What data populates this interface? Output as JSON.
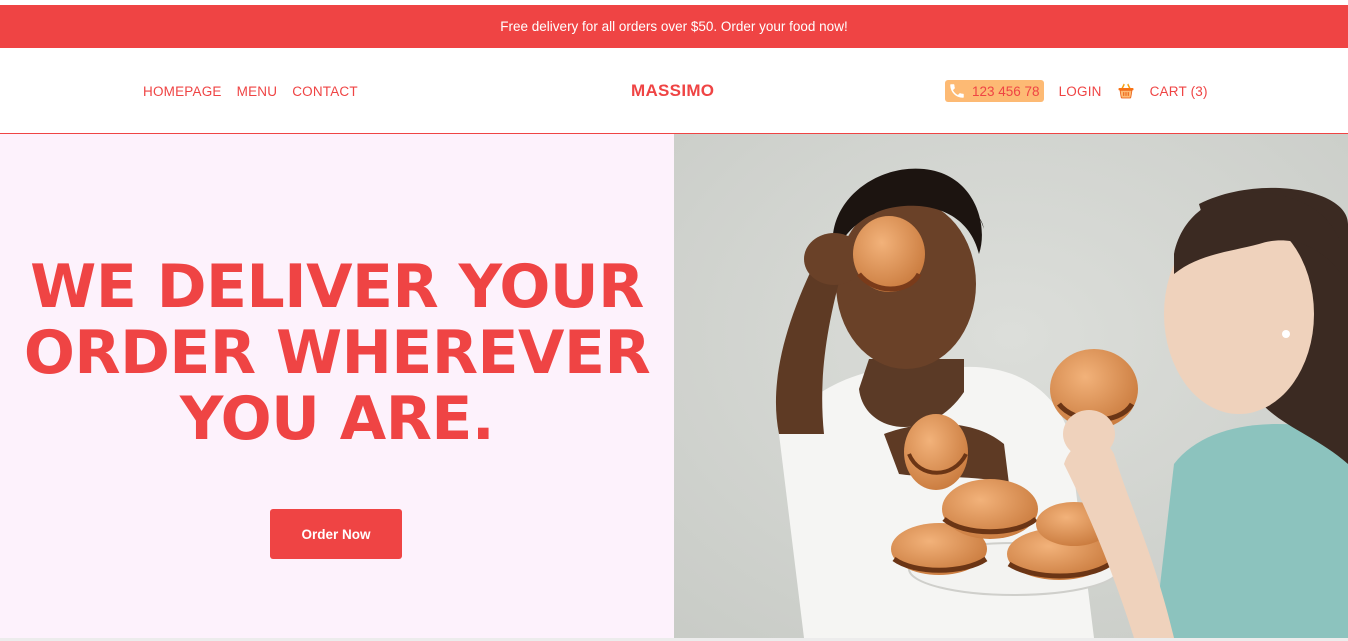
{
  "promo_banner": {
    "text": "Free delivery for all orders over $50. Order your food now!"
  },
  "header": {
    "nav": [
      {
        "label": "HOMEPAGE"
      },
      {
        "label": "MENU"
      },
      {
        "label": "CONTACT"
      }
    ],
    "brand": "MASSIMO",
    "phone": {
      "icon": "phone-icon",
      "number": "123 456 78"
    },
    "login_label": "LOGIN",
    "cart": {
      "icon": "shopping-basket-icon",
      "label": "CART (3)"
    }
  },
  "hero": {
    "headline_lines": [
      "WE DELIVER YOUR",
      "ORDER WHEREVER",
      "YOU ARE."
    ],
    "cta_label": "Order Now",
    "image": "two women eating burgers"
  },
  "colors": {
    "accent": "#ef4444",
    "phone_pill": "#fdba74",
    "hero_left_bg": "#fdf2fc"
  }
}
